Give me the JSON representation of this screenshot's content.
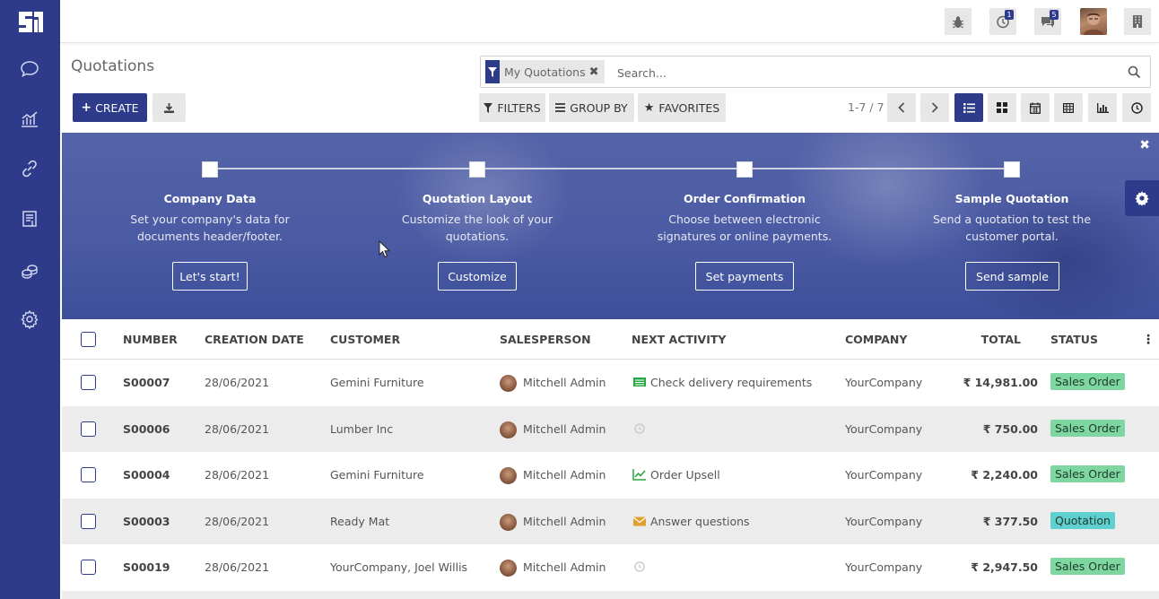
{
  "colors": {
    "brand": "#2d3b8a",
    "sales_order": "#7ed6a0",
    "quotation": "#5fd0cf"
  },
  "topbar": {
    "activity_count": "1",
    "messages_count": "5"
  },
  "page": {
    "title": "Quotations"
  },
  "toolbar": {
    "create_label": "CREATE"
  },
  "search": {
    "facet_label": "My Quotations",
    "placeholder": "Search..."
  },
  "filters": {
    "filters_label": "FILTERS",
    "groupby_label": "GROUP BY",
    "favorites_label": "FAVORITES"
  },
  "pager": {
    "text": "1-7 / 7"
  },
  "onboarding": {
    "steps": [
      {
        "title": "Company Data",
        "desc1": "Set your company's data for",
        "desc2": "documents header/footer.",
        "button": "Let's start!"
      },
      {
        "title": "Quotation Layout",
        "desc1": "Customize the look of your",
        "desc2": "quotations.",
        "button": "Customize"
      },
      {
        "title": "Order Confirmation",
        "desc1": "Choose between electronic",
        "desc2": "signatures or online payments.",
        "button": "Set payments"
      },
      {
        "title": "Sample Quotation",
        "desc1": "Send a quotation to test the",
        "desc2": "customer portal.",
        "button": "Send sample"
      }
    ]
  },
  "table": {
    "headers": {
      "number": "NUMBER",
      "creation_date": "CREATION DATE",
      "customer": "CUSTOMER",
      "salesperson": "SALESPERSON",
      "next_activity": "NEXT ACTIVITY",
      "company": "COMPANY",
      "total": "TOTAL",
      "status": "STATUS"
    },
    "rows": [
      {
        "number": "S00007",
        "date": "28/06/2021",
        "customer": "Gemini Furniture",
        "salesperson": "Mitchell Admin",
        "activity": "Check delivery requirements",
        "activity_icon": "tasks-icon",
        "company": "YourCompany",
        "total": "₹ 14,981.00",
        "status": "Sales Order"
      },
      {
        "number": "S00006",
        "date": "28/06/2021",
        "customer": "Lumber Inc",
        "salesperson": "Mitchell Admin",
        "activity": "",
        "activity_icon": "clock-icon",
        "company": "YourCompany",
        "total": "₹ 750.00",
        "status": "Sales Order"
      },
      {
        "number": "S00004",
        "date": "28/06/2021",
        "customer": "Gemini Furniture",
        "salesperson": "Mitchell Admin",
        "activity": "Order Upsell",
        "activity_icon": "line-chart-icon",
        "company": "YourCompany",
        "total": "₹ 2,240.00",
        "status": "Sales Order"
      },
      {
        "number": "S00003",
        "date": "28/06/2021",
        "customer": "Ready Mat",
        "salesperson": "Mitchell Admin",
        "activity": "Answer questions",
        "activity_icon": "envelope-icon",
        "company": "YourCompany",
        "total": "₹ 377.50",
        "status": "Quotation"
      },
      {
        "number": "S00019",
        "date": "28/06/2021",
        "customer": "YourCompany, Joel Willis",
        "salesperson": "Mitchell Admin",
        "activity": "",
        "activity_icon": "clock-icon",
        "company": "YourCompany",
        "total": "₹ 2,947.50",
        "status": "Sales Order"
      }
    ]
  }
}
